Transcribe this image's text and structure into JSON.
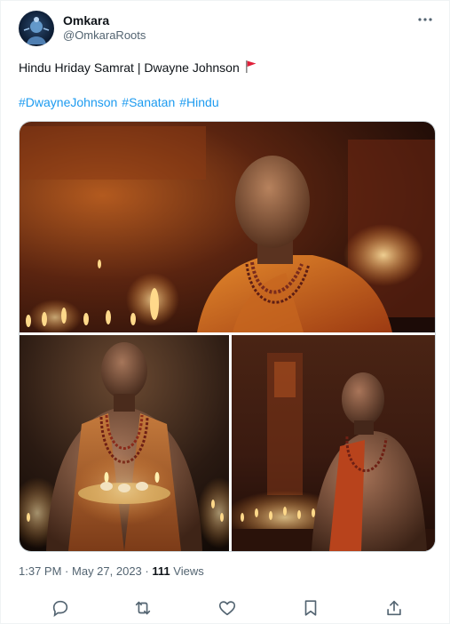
{
  "author": {
    "name": "Omkara",
    "handle": "@OmkaraRoots"
  },
  "tweet": {
    "text": "Hindu Hriday Samrat | Dwayne Johnson",
    "hashtags": [
      "#DwayneJohnson",
      "#Sanatan",
      "#Hindu"
    ]
  },
  "media": {
    "images": [
      "temple-portrait",
      "holding-diya-plate",
      "seated-meditation"
    ]
  },
  "meta": {
    "time": "1:37 PM",
    "separator": "·",
    "date": "May 27, 2023",
    "views_count": "111",
    "views_label": "Views"
  },
  "icons": {
    "more": "more-horizontal-icon",
    "reply": "reply-icon",
    "retweet": "retweet-icon",
    "like": "heart-icon",
    "bookmark": "bookmark-icon",
    "share": "share-icon",
    "flag": "red-flag-emoji"
  },
  "colors": {
    "link": "#1d9bf0",
    "secondary_text": "#536471",
    "primary_text": "#0f1419",
    "icon": "#536471"
  }
}
